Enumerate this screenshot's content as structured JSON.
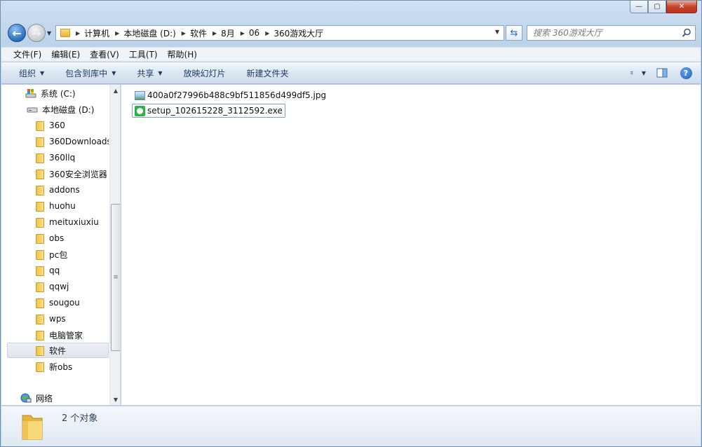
{
  "window": {
    "caption_buttons": {
      "minimize": "—",
      "maximize": "▢",
      "close": "✕"
    }
  },
  "navigation": {
    "back_icon": "back-arrow-icon",
    "forward_icon": "forward-arrow-icon"
  },
  "breadcrumb": [
    "计算机",
    "本地磁盘 (D:)",
    "软件",
    "8月",
    "06",
    "360游戏大厅"
  ],
  "search": {
    "placeholder": "搜索 360游戏大厅"
  },
  "menubar": [
    "文件(F)",
    "编辑(E)",
    "查看(V)",
    "工具(T)",
    "帮助(H)"
  ],
  "commandbar": {
    "organize": "组织",
    "include_in_library": "包含到库中",
    "share": "共享",
    "slideshow": "放映幻灯片",
    "new_folder": "新建文件夹"
  },
  "nav_tree": {
    "drives": [
      {
        "label": "系统 (C:)",
        "icon": "system-drive-icon"
      },
      {
        "label": "本地磁盘 (D:)",
        "icon": "local-disk-icon"
      }
    ],
    "folders": [
      "360",
      "360Downloads",
      "360llq",
      "360安全浏览器",
      "addons",
      "huohu",
      "meituxiuxiu",
      "obs",
      "pc包",
      "qq",
      "qqwj",
      "sougou",
      "wps",
      "电脑管家",
      "软件",
      "新obs"
    ],
    "selected": "软件",
    "network": "网络"
  },
  "files": [
    {
      "name": "400a0f27996b488c9bf511856d499df5.jpg",
      "icon": "image-file-icon"
    },
    {
      "name": "setup_102615228_3112592.exe",
      "icon": "exe-file-icon"
    }
  ],
  "details": {
    "status": "2 个对象"
  }
}
